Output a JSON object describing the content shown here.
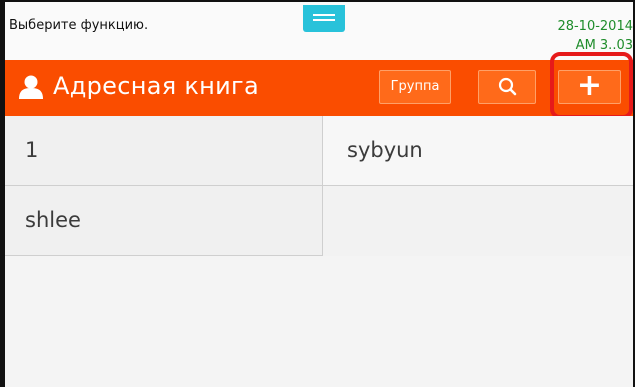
{
  "status": {
    "message": "Выберите функцию.",
    "date": "28-10-2014",
    "time": "AM 3..03"
  },
  "header": {
    "title": "Адресная книга",
    "icon": "person-icon",
    "group_label": "Группа",
    "search_icon": "search-icon",
    "add_label": "+"
  },
  "contacts": [
    {
      "name": "1"
    },
    {
      "name": "sybyun"
    },
    {
      "name": "shlee"
    }
  ],
  "colors": {
    "header": "#fa4d00",
    "button": "#ff6a1a",
    "highlight": "#e61a1a",
    "handle": "#28c2da",
    "clock": "#1e8c2a"
  }
}
